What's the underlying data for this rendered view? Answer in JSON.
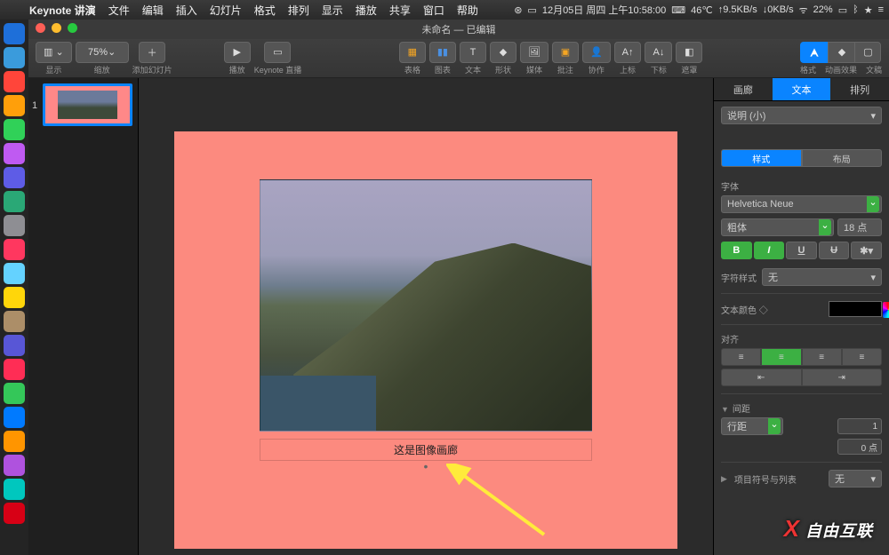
{
  "menubar": {
    "app_name": "Keynote 讲演",
    "items": [
      "文件",
      "编辑",
      "插入",
      "幻灯片",
      "格式",
      "排列",
      "显示",
      "播放",
      "共享",
      "窗口",
      "帮助"
    ],
    "status": {
      "date": "12月05日 周四 上午10:58:00",
      "temp": "46℃",
      "net_up": "↑9.5KB/s",
      "net_down": "↓0KB/s",
      "battery": "22%"
    }
  },
  "window": {
    "title": "未命名 — 已编辑"
  },
  "toolbar": {
    "view_label": "显示",
    "zoom_value": "75%",
    "zoom_label": "缩放",
    "add_slide_label": "添加幻灯片",
    "play_label": "播放",
    "live_label": "Keynote 直播",
    "table_label": "表格",
    "chart_label": "图表",
    "text_label": "文本",
    "shape_label": "形状",
    "media_label": "媒体",
    "comment_label": "批注",
    "collab_label": "协作",
    "super_label": "上标",
    "sub_label": "下标",
    "mask_label": "遮罩",
    "format_label": "格式",
    "animate_label": "动画效果",
    "document_label": "文稿"
  },
  "navigator": {
    "slide1_num": "1"
  },
  "slide": {
    "caption": "这是图像画廊",
    "dot": "•"
  },
  "inspector": {
    "tabs": {
      "gallery": "画廊",
      "text": "文本",
      "arrange": "排列"
    },
    "paragraph_style": "说明 (小)",
    "sub_tabs": {
      "style": "样式",
      "layout": "布局"
    },
    "font_label": "字体",
    "font_family": "Helvetica Neue",
    "font_weight": "粗体",
    "font_size": "18 点",
    "bold": "B",
    "italic": "I",
    "underline": "U",
    "strike": "S",
    "char_style_label": "字符样式",
    "char_style_value": "无",
    "text_color_label": "文本颜色",
    "align_label": "对齐",
    "spacing_label": "间距",
    "line_spacing_label": "行距",
    "line_spacing_value": "1",
    "para_before_value": "0 点",
    "bullets_label": "项目符号与列表",
    "bullets_value": "无"
  },
  "dock_colors": [
    "#1e6fd9",
    "#3a9bdc",
    "#ff453a",
    "#ff9f0a",
    "#30d158",
    "#bf5af2",
    "#5e5ce6",
    "#2aa876",
    "#8e8e93",
    "#ff375f",
    "#64d2ff",
    "#ffd60a",
    "#ac8e68",
    "#5856d6",
    "#ff2d55",
    "#34c759",
    "#007aff",
    "#ff9500",
    "#af52de",
    "#00c7be",
    "#8e8e93",
    "#d70015",
    "#32ade6",
    "#ff6482",
    "#a2845e"
  ]
}
